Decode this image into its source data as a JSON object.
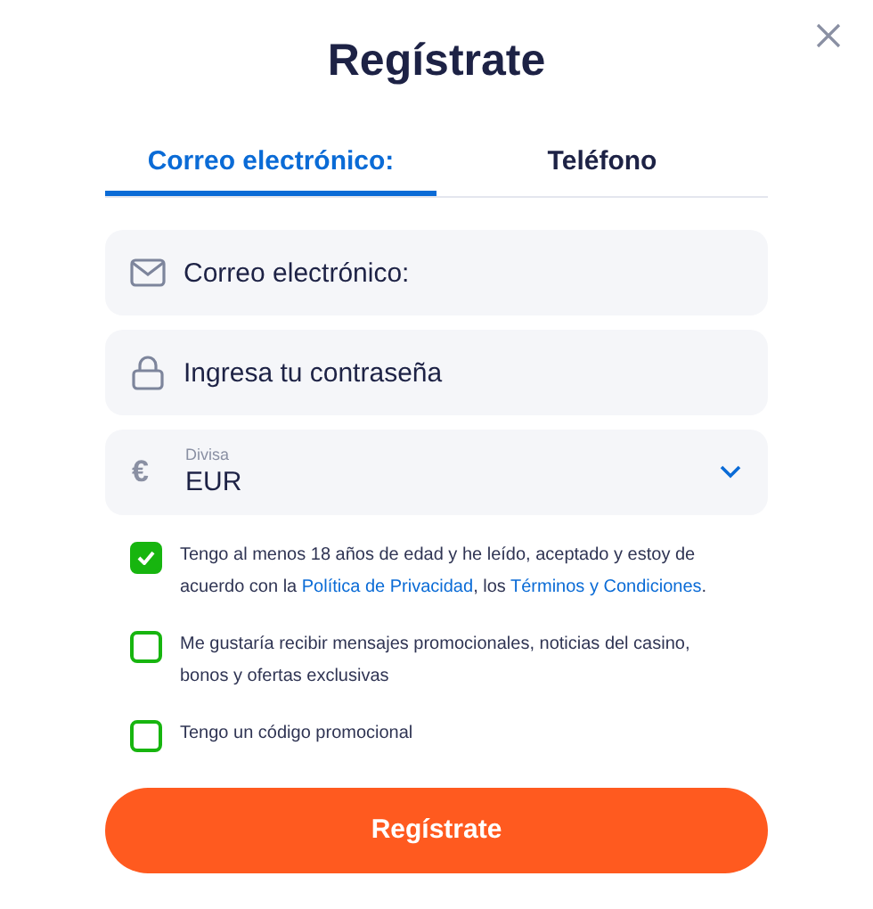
{
  "title": "Regístrate",
  "tabs": [
    {
      "label": "Correo electrónico:",
      "selected": true
    },
    {
      "label": "Teléfono",
      "selected": false
    }
  ],
  "fields": [
    {
      "kind": "email",
      "placeholder": "Correo electrónico:"
    },
    {
      "kind": "password",
      "placeholder": "Ingresa tu contraseña"
    },
    {
      "kind": "select",
      "symbol": "€",
      "label": "Divisa",
      "value": "EUR"
    }
  ],
  "checkboxes": [
    {
      "checked": true,
      "parts": [
        {
          "kind": "text",
          "text": "Tengo al menos 18 años de edad y he leído, aceptado y estoy de acuerdo con la "
        },
        {
          "kind": "link",
          "text": "Política de Privacidad"
        },
        {
          "kind": "text",
          "text": ", los "
        },
        {
          "kind": "link",
          "text": "Términos y Condiciones"
        },
        {
          "kind": "text",
          "text": "."
        }
      ]
    },
    {
      "checked": false,
      "parts": [
        {
          "kind": "text",
          "text": "Me gustaría recibir mensajes promocionales, noticias del casino, bonos y ofertas exclusivas"
        }
      ]
    },
    {
      "checked": false,
      "parts": [
        {
          "kind": "text",
          "text": "Tengo un código promocional"
        }
      ]
    }
  ],
  "submit": "Regístrate"
}
